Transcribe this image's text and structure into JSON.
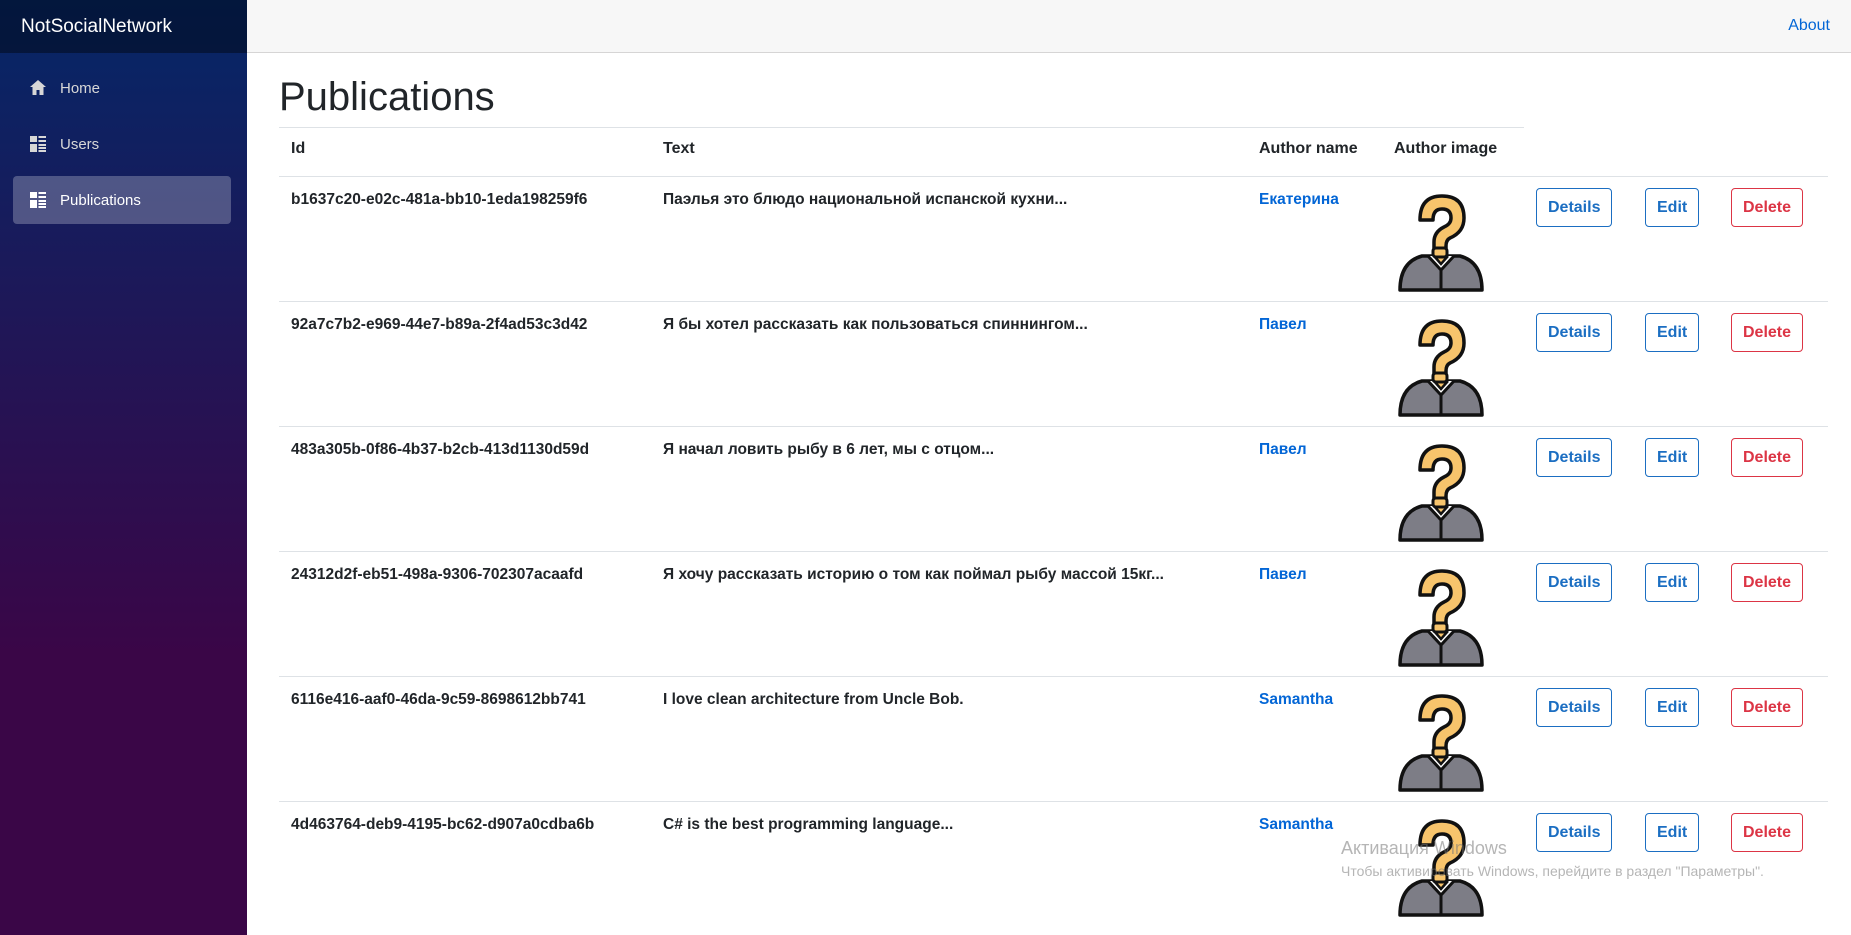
{
  "brand": "NotSocialNetwork",
  "nav": [
    {
      "label": "Home",
      "icon": "home-icon"
    },
    {
      "label": "Users",
      "icon": "list-icon"
    },
    {
      "label": "Publications",
      "icon": "list-icon",
      "active": true
    }
  ],
  "topbar": {
    "about": "About"
  },
  "page": {
    "title": "Publications"
  },
  "table": {
    "headers": {
      "id": "Id",
      "text": "Text",
      "author_name": "Author name",
      "author_image": "Author image"
    },
    "buttons": {
      "details": "Details",
      "edit": "Edit",
      "delete": "Delete"
    },
    "rows": [
      {
        "id": "b1637c20-e02c-481a-bb10-1eda198259f6",
        "text": "Паэлья это блюдо национальной испанской кухни...",
        "author": "Екатерина",
        "author_image": "question-avatar-icon"
      },
      {
        "id": "92a7c7b2-e969-44e7-b89a-2f4ad53c3d42",
        "text": "Я бы хотел рассказать как пользоваться спиннингом...",
        "author": "Павел",
        "author_image": "question-avatar-icon"
      },
      {
        "id": "483a305b-0f86-4b37-b2cb-413d1130d59d",
        "text": "Я начал ловить рыбу в 6 лет, мы с отцом...",
        "author": "Павел",
        "author_image": "question-avatar-icon"
      },
      {
        "id": "24312d2f-eb51-498a-9306-702307acaafd",
        "text": "Я хочу рассказать историю о том как поймал рыбу массой 15кг...",
        "author": "Павел",
        "author_image": "question-avatar-icon"
      },
      {
        "id": "6116e416-aaf0-46da-9c59-8698612bb741",
        "text": "I love clean architecture from Uncle Bob.",
        "author": "Samantha",
        "author_image": "question-avatar-icon"
      },
      {
        "id": "4d463764-deb9-4195-bc62-d907a0cdba6b",
        "text": "C# is the best programming language...",
        "author": "Samantha",
        "author_image": "question-avatar-icon"
      }
    ]
  },
  "watermark": {
    "title": "Активация Windows",
    "subtitle": "Чтобы активировать Windows, перейдите в раздел \"Параметры\"."
  },
  "colors": {
    "sidebar_top": "#052767",
    "sidebar_bottom": "#3a0647",
    "link": "#0366d6",
    "primary": "#1b6ec2",
    "danger": "#dc3545"
  }
}
